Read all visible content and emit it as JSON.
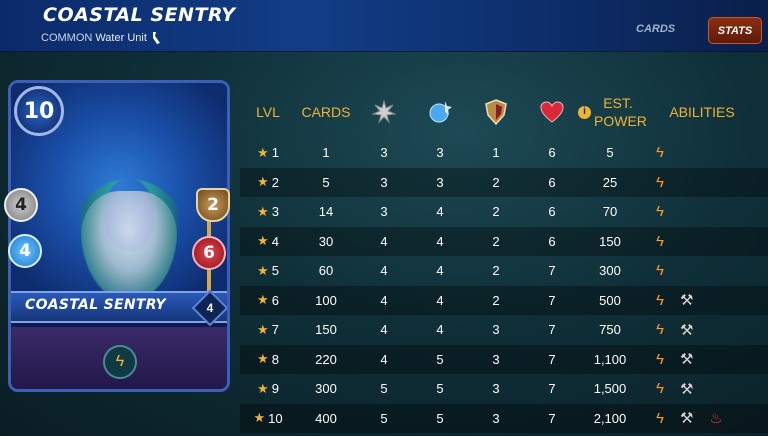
{
  "header": {
    "title": "COASTAL SENTRY",
    "rarity": "COMMON",
    "subtitle": "Water Unit",
    "tabs": {
      "cards": "CARDS",
      "stats": "STATS"
    }
  },
  "card": {
    "name": "COASTAL SENTRY",
    "mana": "10",
    "level": "4",
    "melee": "4",
    "magic": "4",
    "armor": "2",
    "health": "6"
  },
  "table": {
    "headers": {
      "lvl": "LVL",
      "cards": "CARDS",
      "power": "EST. POWER",
      "abilities": "ABILITIES"
    },
    "rows": [
      {
        "lvl": "1",
        "cards": "1",
        "melee": "3",
        "magic": "3",
        "armor": "1",
        "health": "6",
        "power": "5",
        "abilities": 1
      },
      {
        "lvl": "2",
        "cards": "5",
        "melee": "3",
        "magic": "3",
        "armor": "2",
        "health": "6",
        "power": "25",
        "abilities": 1
      },
      {
        "lvl": "3",
        "cards": "14",
        "melee": "3",
        "magic": "4",
        "armor": "2",
        "health": "6",
        "power": "70",
        "abilities": 1
      },
      {
        "lvl": "4",
        "cards": "30",
        "melee": "4",
        "magic": "4",
        "armor": "2",
        "health": "6",
        "power": "150",
        "abilities": 1
      },
      {
        "lvl": "5",
        "cards": "60",
        "melee": "4",
        "magic": "4",
        "armor": "2",
        "health": "7",
        "power": "300",
        "abilities": 1
      },
      {
        "lvl": "6",
        "cards": "100",
        "melee": "4",
        "magic": "4",
        "armor": "2",
        "health": "7",
        "power": "500",
        "abilities": 2
      },
      {
        "lvl": "7",
        "cards": "150",
        "melee": "4",
        "magic": "4",
        "armor": "3",
        "health": "7",
        "power": "750",
        "abilities": 2
      },
      {
        "lvl": "8",
        "cards": "220",
        "melee": "4",
        "magic": "5",
        "armor": "3",
        "health": "7",
        "power": "1,100",
        "abilities": 2
      },
      {
        "lvl": "9",
        "cards": "300",
        "melee": "5",
        "magic": "5",
        "armor": "3",
        "health": "7",
        "power": "1,500",
        "abilities": 2
      },
      {
        "lvl": "10",
        "cards": "400",
        "melee": "5",
        "magic": "5",
        "armor": "3",
        "health": "7",
        "power": "2,100",
        "abilities": 3
      }
    ]
  },
  "icons": {
    "melee": "melee-attack-icon",
    "magic": "magic-attack-icon",
    "armor": "armor-shield-icon",
    "health": "health-heart-icon",
    "info": "info-icon",
    "ability_1": "lightning-ability-icon",
    "ability_2": "trap-ability-icon",
    "ability_3": "fire-ability-icon",
    "water": "water-element-icon"
  },
  "colors": {
    "accent": "#f2b233",
    "tab_active": "#8a2e12"
  }
}
